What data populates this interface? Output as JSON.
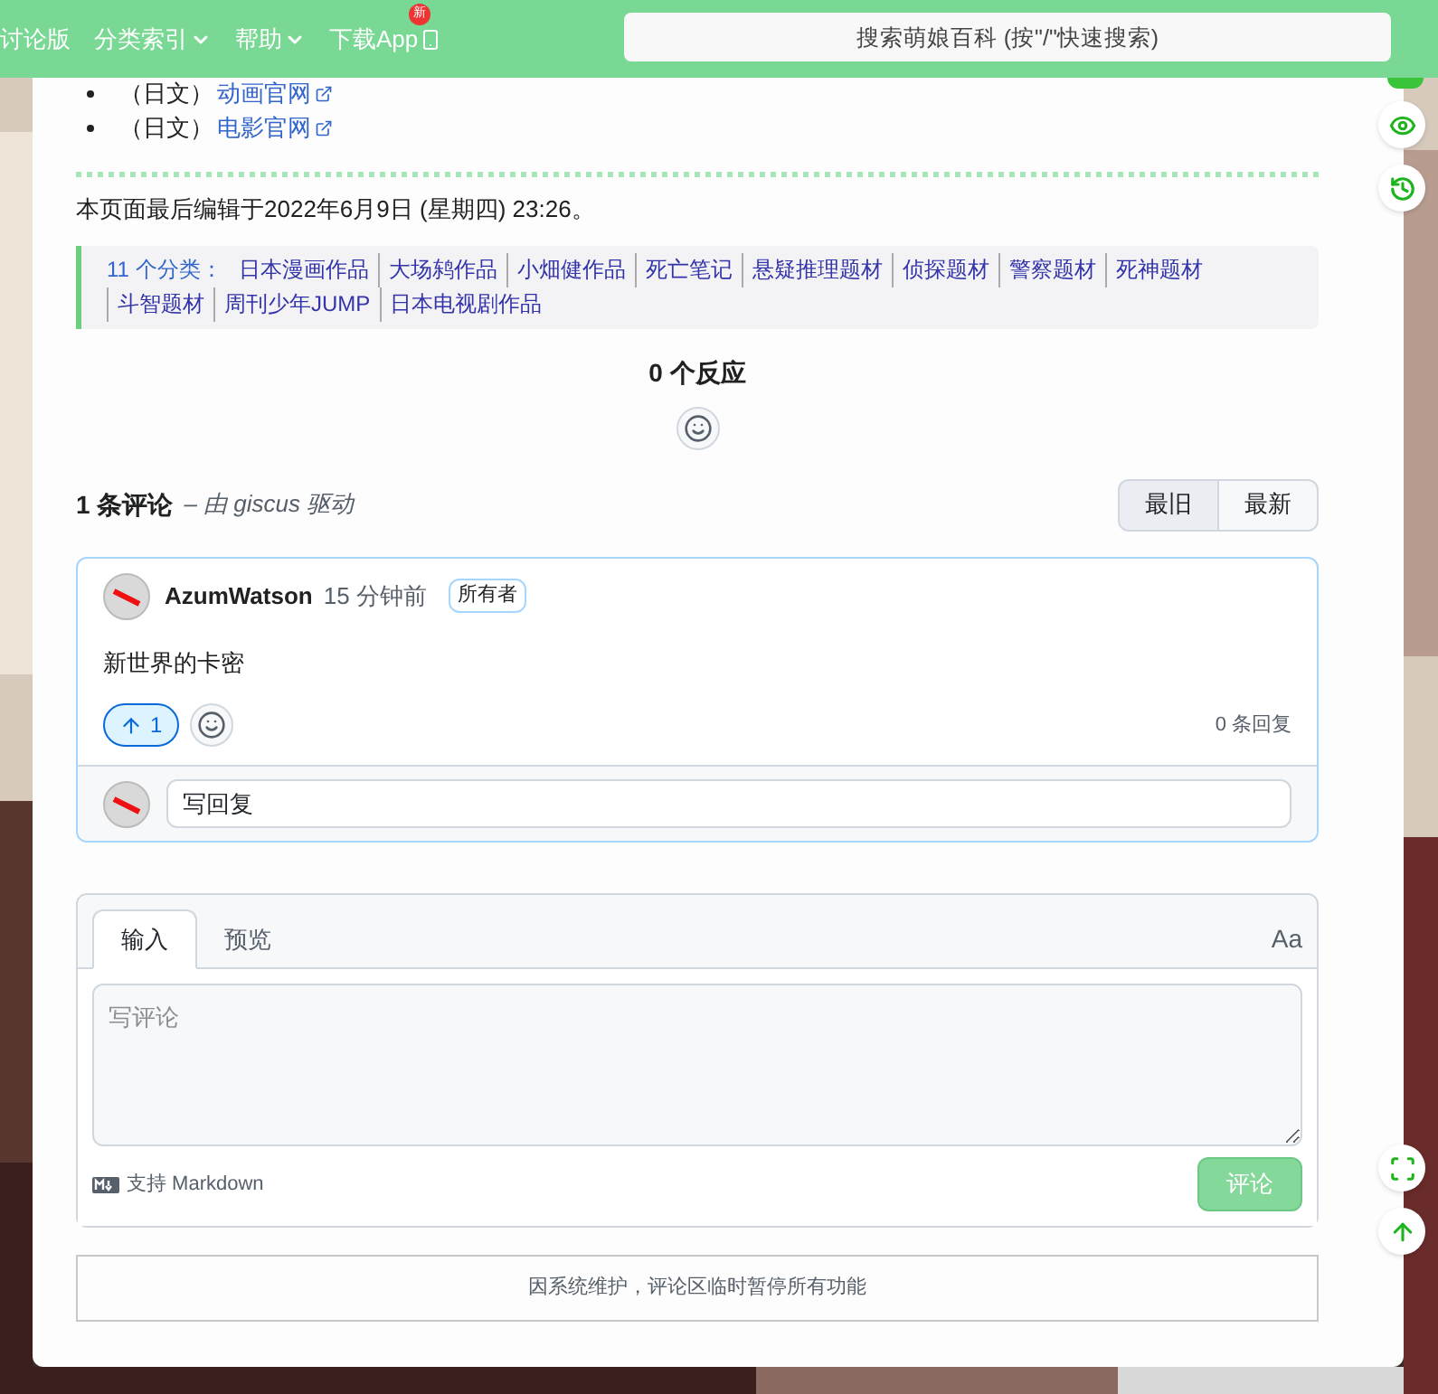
{
  "nav": {
    "items": [
      {
        "label": "讨论版",
        "dropdown": false
      },
      {
        "label": "分类索引",
        "dropdown": true
      },
      {
        "label": "帮助",
        "dropdown": true
      },
      {
        "label": "下载App",
        "dropdown": false,
        "badge": "新"
      }
    ],
    "search": {
      "placeholder": "搜索萌娘百科 (按\"/\"快速搜索)"
    }
  },
  "links": [
    {
      "prefix": "（日文）",
      "label": "动画官网"
    },
    {
      "prefix": "（日文）",
      "label": "电影官网"
    }
  ],
  "last_edited": "本页面最后编辑于2022年6月9日 (星期四) 23:26。",
  "categories": {
    "label": "11 个分类：",
    "items": [
      "日本漫画作品",
      "大场鸫作品",
      "小畑健作品",
      "死亡笔记",
      "悬疑推理题材",
      "侦探题材",
      "警察题材",
      "死神题材",
      "斗智题材",
      "周刊少年JUMP",
      "日本电视剧作品"
    ]
  },
  "reactions": {
    "title": "0 个反应"
  },
  "comments": {
    "count": "1 条评论",
    "powered_by": "– 由 giscus 驱动",
    "sort": [
      {
        "label": "最旧",
        "selected": true
      },
      {
        "label": "最新",
        "selected": false
      }
    ],
    "items": [
      {
        "author": "AzumWatson",
        "time": "15 分钟前",
        "badge": "所有者",
        "body": "新世界的卡密",
        "upvotes": "1",
        "upvoted": true,
        "replies": "0 条回复",
        "reply_placeholder": "写回复"
      }
    ]
  },
  "editor": {
    "tabs": [
      {
        "label": "输入",
        "selected": true
      },
      {
        "label": "预览",
        "selected": false
      }
    ],
    "font_toggle": "Aa",
    "placeholder": "写评论",
    "markdown_note": "支持 Markdown",
    "submit": "评论",
    "submit_disabled": true
  },
  "notice": "因系统维护，评论区临时暂停所有功能"
}
